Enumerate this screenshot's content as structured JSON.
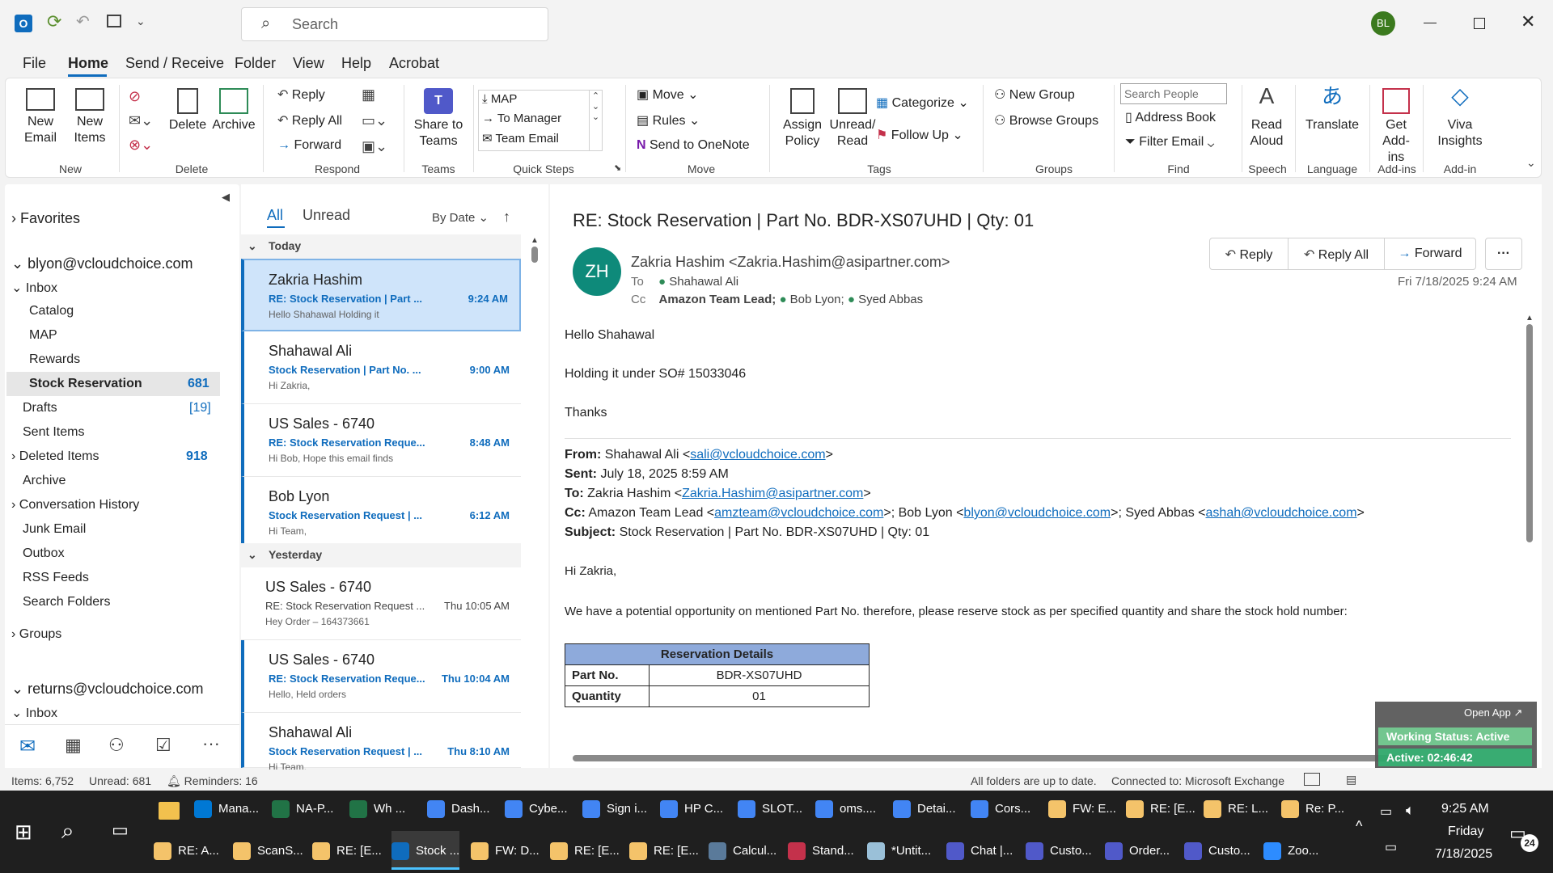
{
  "titlebar": {
    "search_placeholder": "Search",
    "avatar": "BL"
  },
  "menu": [
    "File",
    "Home",
    "Send / Receive",
    "Folder",
    "View",
    "Help",
    "Acrobat"
  ],
  "ribbon": {
    "new_email": "New Email",
    "new_items": "New Items",
    "delete": "Delete",
    "archive": "Archive",
    "reply": "Reply",
    "reply_all": "Reply All",
    "forward": "Forward",
    "share_teams": "Share to Teams",
    "quick_steps": [
      "MAP",
      "To Manager",
      "Team Email"
    ],
    "move": "Move",
    "rules": "Rules",
    "send_onenote": "Send to OneNote",
    "assign_policy": "Assign Policy",
    "unread_read": "Unread/ Read",
    "categorize": "Categorize",
    "follow_up": "Follow Up",
    "new_group": "New Group",
    "browse_groups": "Browse Groups",
    "search_people": "Search People",
    "address_book": "Address Book",
    "filter_email": "Filter Email",
    "read_aloud": "Read Aloud",
    "translate": "Translate",
    "get_addins": "Get Add-ins",
    "viva": "Viva Insights",
    "groups": [
      "New",
      "Delete",
      "Respond",
      "Teams",
      "Quick Steps",
      "Move",
      "Tags",
      "Groups",
      "Find",
      "Speech",
      "Language",
      "Add-ins",
      "Add-in"
    ]
  },
  "folders": {
    "favorites": "Favorites",
    "account1": "blyon@vcloudchoice.com",
    "inbox": "Inbox",
    "subfolders": [
      "Catalog",
      "MAP",
      "Rewards"
    ],
    "stock": "Stock Reservation",
    "stock_count": "681",
    "drafts": "Drafts",
    "drafts_count": "[19]",
    "sent": "Sent Items",
    "deleted": "Deleted Items",
    "deleted_count": "918",
    "archive": "Archive",
    "conv_history": "Conversation History",
    "junk": "Junk Email",
    "outbox": "Outbox",
    "rss": "RSS Feeds",
    "search_folders": "Search Folders",
    "groups": "Groups",
    "account2": "returns@vcloudchoice.com",
    "inbox2": "Inbox"
  },
  "list": {
    "tab_all": "All",
    "tab_unread": "Unread",
    "sort": "By Date",
    "today": "Today",
    "yesterday": "Yesterday",
    "items": [
      {
        "sender": "Zakria Hashim",
        "subject": "RE: Stock Reservation | Part ...",
        "time": "9:24 AM",
        "preview": "Hello Shahawal  Holding it"
      },
      {
        "sender": "Shahawal Ali",
        "subject": "Stock Reservation | Part No. ...",
        "time": "9:00 AM",
        "preview": "Hi Zakria,"
      },
      {
        "sender": "US Sales - 6740",
        "subject": "RE: Stock Reservation Reque...",
        "time": "8:48 AM",
        "preview": "Hi Bob,  Hope this email finds"
      },
      {
        "sender": "Bob Lyon",
        "subject": "Stock Reservation Request | ...",
        "time": "6:12 AM",
        "preview": "Hi Team,"
      },
      {
        "sender": "US Sales - 6740",
        "subject": "RE: Stock Reservation Request ...",
        "time": "Thu 10:05 AM",
        "preview": "Hey  Order – 164373661"
      },
      {
        "sender": "US Sales - 6740",
        "subject": "RE: Stock Reservation Reque...",
        "time": "Thu 10:04 AM",
        "preview": "Hello,  Held orders"
      },
      {
        "sender": "Shahawal Ali",
        "subject": "Stock Reservation Request | ...",
        "time": "Thu 8:10 AM",
        "preview": "Hi Team,"
      }
    ]
  },
  "email": {
    "subject": "RE: Stock Reservation | Part No. BDR-XS07UHD | Qty: 01",
    "initials": "ZH",
    "from": "Zakria Hashim <Zakria.Hashim@asipartner.com>",
    "to_label": "To",
    "to": "Shahawal Ali",
    "cc_label": "Cc",
    "cc1": "Amazon Team Lead;",
    "cc2": "Bob Lyon;",
    "cc3": "Syed Abbas",
    "date": "Fri 7/18/2025 9:24 AM",
    "reply": "Reply",
    "reply_all": "Reply All",
    "forward": "Forward",
    "line1": "Hello Shahawal",
    "line2": "Holding it under SO# 15033046",
    "line3": "Thanks",
    "from_label": "From:",
    "from_val": "Shahawal Ali <",
    "from_email": "sali@vcloudchoice.com",
    "sent_label": "Sent:",
    "sent_val": "July 18, 2025 8:59 AM",
    "to2_label": "To:",
    "to2_val": "Zakria Hashim <",
    "to2_email": "Zakria.Hashim@asipartner.com",
    "cc2_label": "Cc:",
    "cc_a": "Amazon Team Lead <",
    "cc_a_email": "amzteam@vcloudchoice.com",
    "cc_b": ">; Bob Lyon <",
    "cc_b_email": "blyon@vcloudchoice.com",
    "cc_c": ">; Syed Abbas <",
    "cc_c_email": "ashah@vcloudchoice.com",
    "subj_label": "Subject:",
    "subj_val": "Stock Reservation | Part No. BDR-XS07UHD | Qty: 01",
    "greet": "Hi Zakria,",
    "para": "We have a potential opportunity on mentioned Part No. therefore, please reserve stock as per specified quantity and share the stock hold number:",
    "table_title": "Reservation Details",
    "part_label": "Part No.",
    "part_val": "BDR-XS07UHD",
    "qty_label": "Quantity",
    "qty_val": "01",
    "open_app": "Open App ↗",
    "working_status": "Working Status: Active",
    "active_timer": "Active: 02:46:42"
  },
  "status": {
    "items": "Items: 6,752",
    "unread": "Unread: 681",
    "reminders": "Reminders: 16",
    "uptodate": "All folders are up to date.",
    "connected": "Connected to: Microsoft Exchange"
  },
  "taskbar": {
    "row1": [
      "Mana...",
      "NA-P...",
      "Wh ...",
      "Dash...",
      "Cybe...",
      "Sign i...",
      "HP C...",
      "SLOT...",
      "oms....",
      "Detai...",
      "Cors...",
      "FW: E...",
      "RE: [E...",
      "RE: L...",
      "Re: P..."
    ],
    "row2": [
      "RE: A...",
      "ScanS...",
      "RE: [E...",
      "Stock ...",
      "FW: D...",
      "RE: [E...",
      "RE: [E...",
      "Calcul...",
      "Stand...",
      "*Untit...",
      "Chat |...",
      "Custo...",
      "Order...",
      "Custo...",
      "Zoo..."
    ],
    "time": "9:25 AM",
    "day": "Friday",
    "date": "7/18/2025",
    "notif": "24"
  }
}
